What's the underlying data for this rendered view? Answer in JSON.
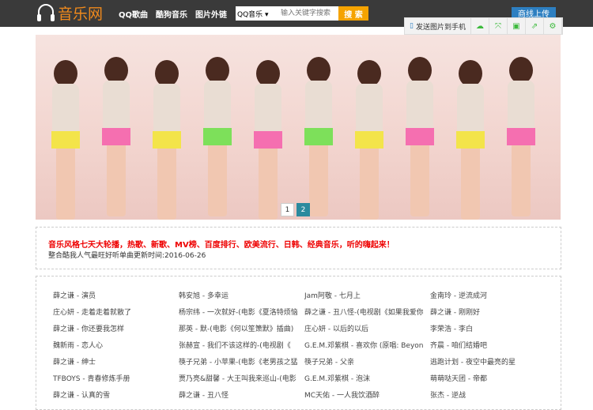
{
  "header": {
    "logo": "音乐网",
    "nav": [
      "QQ歌曲",
      "酷狗音乐",
      "图片外链"
    ],
    "search_select": "QQ音乐",
    "search_placeholder": "输入关键字搜索",
    "search_button": "搜 索",
    "upload_button": "商线上传"
  },
  "toolbar": {
    "send_label": "发送图片到手机",
    "icons": [
      "cloud-icon",
      "expand-icon",
      "save-icon",
      "share-icon",
      "settings-icon"
    ]
  },
  "banner": {
    "pages": [
      "1",
      "2"
    ],
    "active_page": 2
  },
  "notice": {
    "headline": "音乐风格七天大轮播，热歌、新歌、MV榜、百度排行、欧美流行、日韩、经典音乐，听的嗨起来！",
    "subline": "整合酷我人气最旺好听单曲更新时间:2016-06-26"
  },
  "songs": [
    "薛之谦 - 演员",
    "韩安旭 - 多幸运",
    "Jam阿敬 - 七月上",
    "金南玲 - 逆流成河",
    "庄心妍 - 走着走着就散了",
    "杨宗纬 - 一次就好-(电影《夏洛特烦恼》",
    "薛之谦 - 丑八怪-(电视剧《如果我爱你》",
    "薛之谦 - 刚刚好",
    "薛之谦 - 你还要我怎样",
    "那英 - 默-(电影《何以笙箫默》插曲)",
    "庄心妍 - 以后的以后",
    "李荣浩 - 李白",
    "魏新雨 - 恋人心",
    "张赫宣 - 我们不该这样的-(电视剧《",
    "G.E.M.邓紫棋 - 喜欢你 (原唱: Beyon",
    "齐晨 - 咱们结婚吧",
    "薛之谦 - 绅士",
    "筷子兄弟 - 小苹果-(电影《老男孩之猛",
    "筷子兄弟 - 父亲",
    "逃跑计划 - 夜空中最亮的星",
    "TFBOYS - 青春修炼手册",
    "贾乃亮&甜馨 - 大王叫我来巡山-(电影",
    "G.E.M.邓紫棋 - 泡沫",
    "萌萌哒天团 - 帝都",
    "薛之谦 - 认真的雪",
    "薛之谦 - 丑八怪",
    "MC天佑 - 一人我饮酒醉",
    "张杰 - 逆战"
  ]
}
